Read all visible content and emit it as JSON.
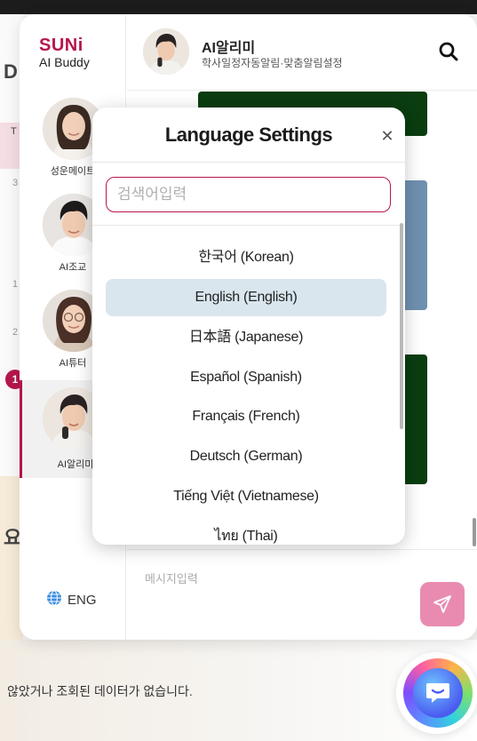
{
  "background": {
    "left_fragments": [
      "D",
      "T",
      "3",
      "1",
      "2",
      "요"
    ],
    "badge": "1",
    "empty_message": "않았거나 조회된 데이터가 없습니다."
  },
  "brand": {
    "name": "SUNi",
    "subtitle": "AI Buddy",
    "accent_color": "#b6164d"
  },
  "agents": [
    {
      "name": "성운메이트",
      "icon": "avatar-woman-icon"
    },
    {
      "name": "AI조교",
      "icon": "avatar-man-icon"
    },
    {
      "name": "AI튜터",
      "icon": "avatar-woman-glasses-icon"
    },
    {
      "name": "AI알리미",
      "icon": "avatar-man-microphone-icon",
      "active": true
    }
  ],
  "language_switch": {
    "label": "ENG",
    "icon": "globe-icon"
  },
  "header": {
    "title": "AI알리미",
    "subtitle": "학사일정자동알림·맞춤알림설정",
    "search_icon": "search-icon"
  },
  "composer": {
    "placeholder": "메시지입력",
    "send_icon": "send-icon",
    "send_color": "#e98bb1"
  },
  "language_modal": {
    "title": "Language Settings",
    "close_icon": "close-icon",
    "search_placeholder": "검색어입력",
    "selected": "English (English)",
    "languages": [
      "한국어 (Korean)",
      "English (English)",
      "日本語 (Japanese)",
      "Español (Spanish)",
      "Français (French)",
      "Deutsch (German)",
      "Tiếng Việt (Vietnamese)",
      "ไทย (Thai)"
    ]
  }
}
